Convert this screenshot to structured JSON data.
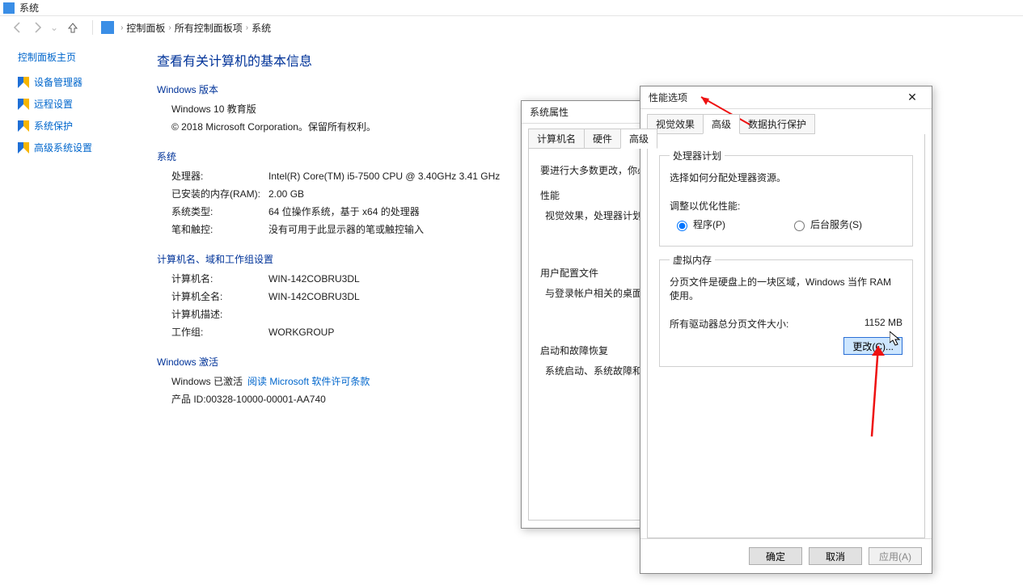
{
  "titlebar": {
    "title": "系统"
  },
  "breadcrumb": {
    "root": "控制面板",
    "all": "所有控制面板项",
    "leaf": "系统"
  },
  "sidebar": {
    "home": "控制面板主页",
    "items": [
      {
        "label": "设备管理器"
      },
      {
        "label": "远程设置"
      },
      {
        "label": "系统保护"
      },
      {
        "label": "高级系统设置"
      }
    ]
  },
  "main": {
    "heading": "查看有关计算机的基本信息",
    "ver_section": "Windows 版本",
    "ver_edition": "Windows 10 教育版",
    "ver_copyright": "© 2018 Microsoft Corporation。保留所有权利。",
    "sys_section": "系统",
    "cpu_label": "处理器:",
    "cpu_value": "Intel(R) Core(TM) i5-7500 CPU @ 3.40GHz   3.41 GHz",
    "ram_label": "已安装的内存(RAM):",
    "ram_value": "2.00 GB",
    "type_label": "系统类型:",
    "type_value": "64 位操作系统，基于 x64 的处理器",
    "pen_label": "笔和触控:",
    "pen_value": "没有可用于此显示器的笔或触控输入",
    "name_section": "计算机名、域和工作组设置",
    "cname_label": "计算机名:",
    "cname_value": "WIN-142COBRU3DL",
    "cfull_label": "计算机全名:",
    "cfull_value": "WIN-142COBRU3DL",
    "cdesc_label": "计算机描述:",
    "cdesc_value": "",
    "wg_label": "工作组:",
    "wg_value": "WORKGROUP",
    "act_section": "Windows 激活",
    "act_status": "Windows 已激活 ",
    "act_link": "阅读 Microsoft 软件许可条款",
    "pid_label": "产品 ID: ",
    "pid_value": "00328-10000-00001-AA740"
  },
  "dlg_sys": {
    "title": "系统属性",
    "tabs": {
      "name": "计算机名",
      "hw": "硬件",
      "adv": "高级"
    },
    "intro": "要进行大多数更改，你必",
    "perf_title": "性能",
    "perf_desc": "视觉效果，处理器计划，",
    "userprof_title": "用户配置文件",
    "userprof_desc": "与登录帐户相关的桌面设",
    "startup_title": "启动和故障恢复",
    "startup_desc": "系统启动、系统故障和调"
  },
  "dlg_perf": {
    "title": "性能选项",
    "tabs": {
      "visual": "视觉效果",
      "adv": "高级",
      "dep": "数据执行保护"
    },
    "sched_title": "处理器计划",
    "sched_desc": "选择如何分配处理器资源。",
    "sched_adjust": "调整以优化性能:",
    "sched_programs": "程序(P)",
    "sched_services": "后台服务(S)",
    "vm_title": "虚拟内存",
    "vm_desc": "分页文件是硬盘上的一块区域，Windows 当作 RAM 使用。",
    "vm_total_label": "所有驱动器总分页文件大小:",
    "vm_total_value": "1152 MB",
    "vm_change": "更改(C)...",
    "ok": "确定",
    "cancel": "取消",
    "apply": "应用(A)"
  }
}
